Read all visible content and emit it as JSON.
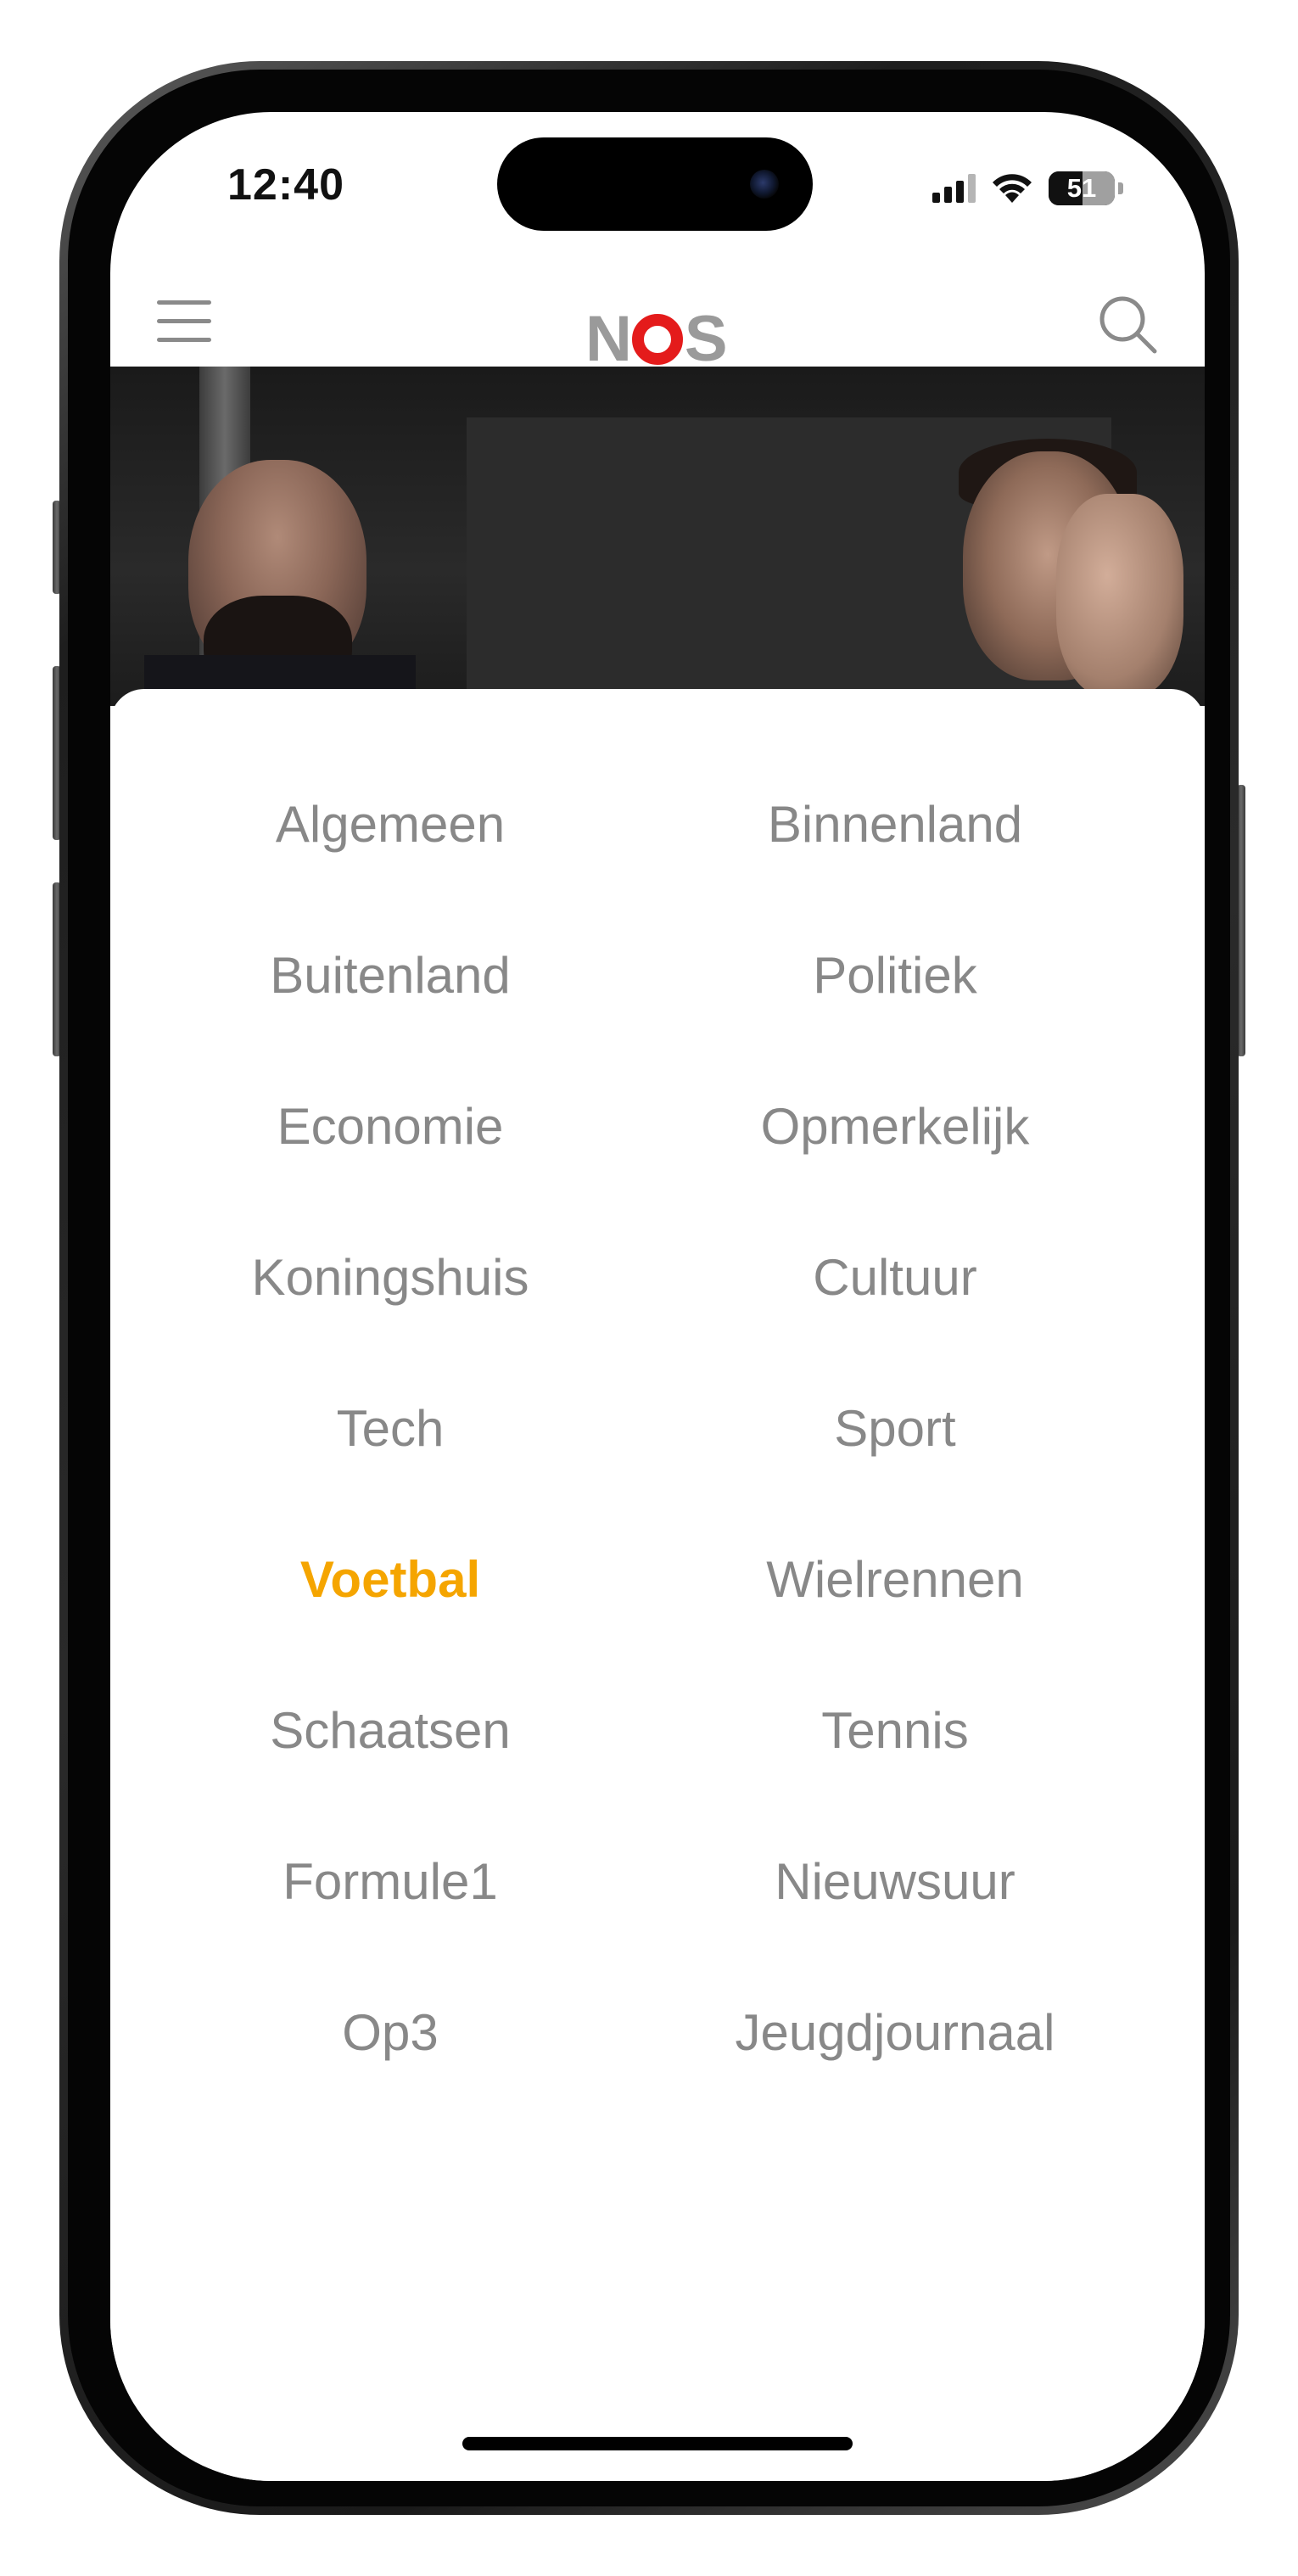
{
  "status_bar": {
    "time": "12:40",
    "battery_level": "51",
    "battery_percent": 51
  },
  "header": {
    "logo_text_left": "N",
    "logo_text_right": "S",
    "menu_icon": "hamburger-menu-icon",
    "search_icon": "search-icon"
  },
  "menu": {
    "accent_color": "#f5a500",
    "text_color": "#888888",
    "items": [
      {
        "label": "Algemeen"
      },
      {
        "label": "Binnenland"
      },
      {
        "label": "Buitenland"
      },
      {
        "label": "Politiek"
      },
      {
        "label": "Economie"
      },
      {
        "label": "Opmerkelijk"
      },
      {
        "label": "Koningshuis"
      },
      {
        "label": "Cultuur"
      },
      {
        "label": "Tech"
      },
      {
        "label": "Sport"
      },
      {
        "label": "Voetbal",
        "active": true
      },
      {
        "label": "Wielrennen"
      },
      {
        "label": "Schaatsen"
      },
      {
        "label": "Tennis"
      },
      {
        "label": "Formule1"
      },
      {
        "label": "Nieuwsuur"
      },
      {
        "label": "Op3"
      },
      {
        "label": "Jeugdjournaal"
      }
    ]
  }
}
